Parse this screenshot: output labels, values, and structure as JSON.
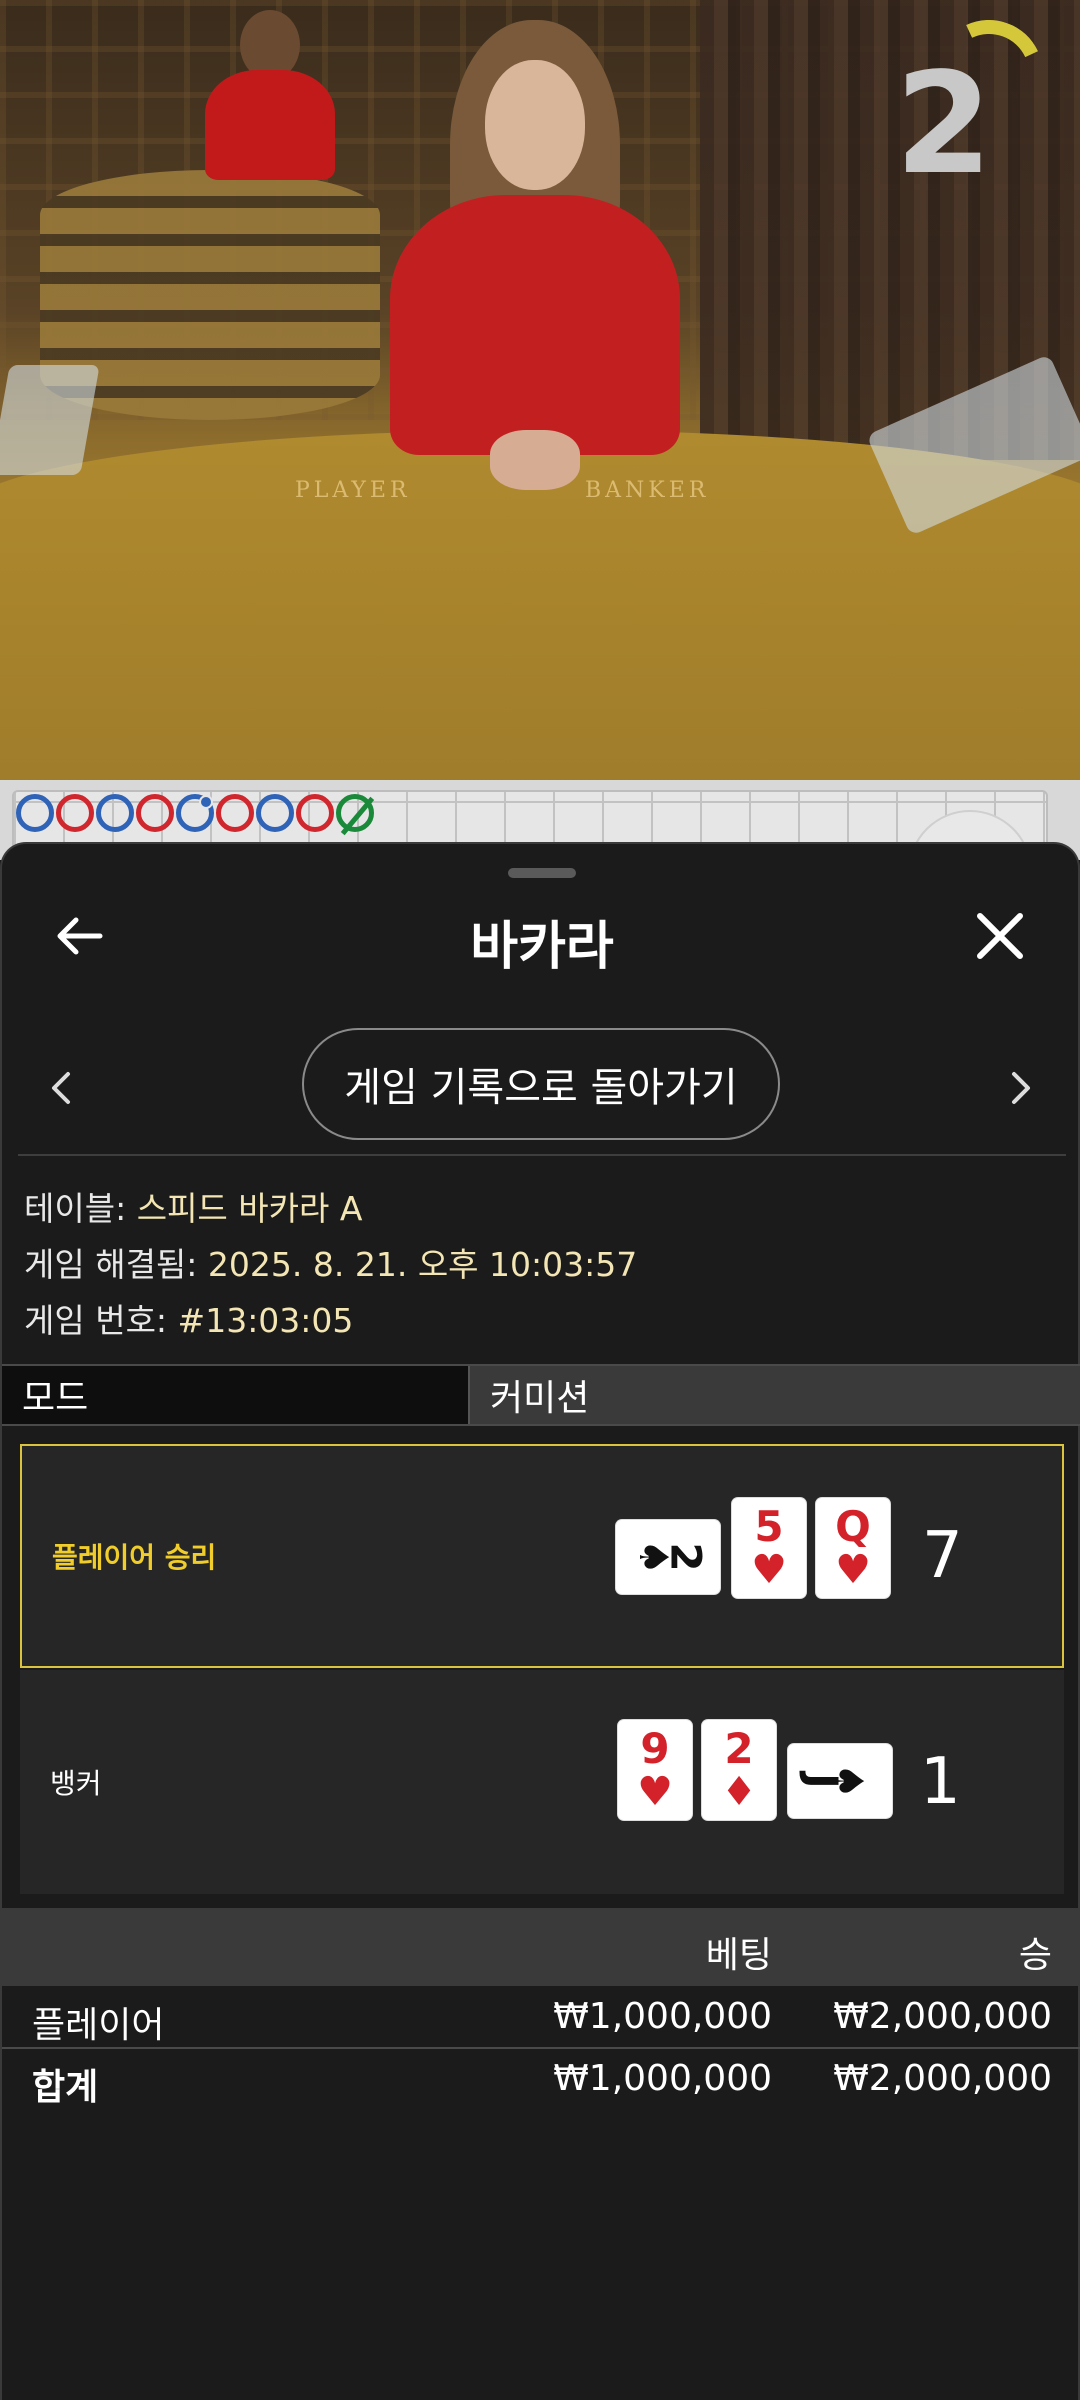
{
  "video": {
    "countdown": "2",
    "felt_left": "PLAYER",
    "felt_right": "BANKER"
  },
  "road": {
    "results": [
      "blue",
      "red",
      "blue",
      "red",
      "blue-dot",
      "red",
      "blue",
      "red",
      "tie"
    ]
  },
  "header": {
    "title": "바카라",
    "back_label": "back",
    "close_label": "close"
  },
  "nav": {
    "history_button": "게임 기록으로 돌아가기"
  },
  "info": {
    "table_label": "테이블: ",
    "table_value": "스피드 바카라 A",
    "resolved_label": "게임 해결됨: ",
    "resolved_value": "2025. 8. 21. 오후 10:03:57",
    "number_label": "게임 번호: ",
    "number_value": "#13:03:05"
  },
  "tabs": {
    "mode": "모드",
    "commission": "커미션"
  },
  "results": {
    "player": {
      "label": "플레이어 승리",
      "score": "7",
      "cards": [
        {
          "rank": "2",
          "suit": "♠",
          "color": "#111111",
          "orientation": "sideways"
        },
        {
          "rank": "5",
          "suit": "♥",
          "color": "#d4222a"
        },
        {
          "rank": "Q",
          "suit": "♥",
          "color": "#d4222a"
        }
      ]
    },
    "banker": {
      "label": "뱅커",
      "score": "1",
      "cards": [
        {
          "rank": "9",
          "suit": "♥",
          "color": "#d4222a"
        },
        {
          "rank": "2",
          "suit": "♦",
          "color": "#d4222a"
        },
        {
          "rank": "J",
          "suit": "♠",
          "color": "#111111",
          "orientation": "sideways"
        }
      ]
    }
  },
  "summary": {
    "col_bet": "베팅",
    "col_win": "승",
    "rows": [
      {
        "name": "플레이어",
        "bet": "₩1,000,000",
        "win": "₩2,000,000"
      }
    ],
    "total": {
      "name": "합계",
      "bet": "₩1,000,000",
      "win": "₩2,000,000"
    }
  },
  "colors": {
    "win_border": "#d9c33f",
    "win_label": "#f0cd2a",
    "info_value": "#f3e6b4",
    "road_blue": "#2f63b7",
    "road_red": "#d0262e",
    "road_tie": "#1a8a3a"
  }
}
